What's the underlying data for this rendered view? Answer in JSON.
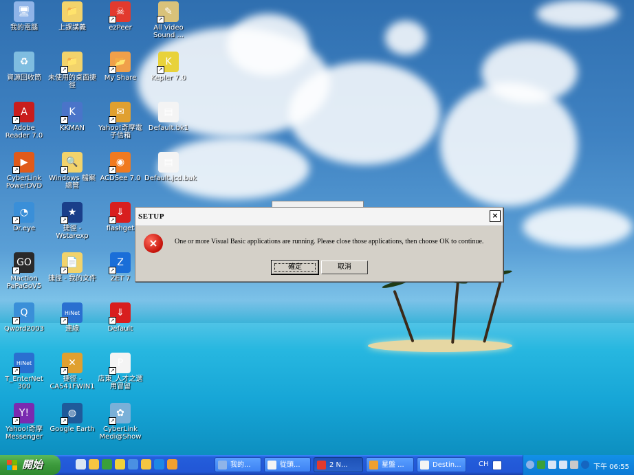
{
  "desktop_icons": [
    {
      "label": "我的電腦",
      "color": "#8fb4e8",
      "glyph": "🖥"
    },
    {
      "label": "上課講義",
      "color": "#f2d36b",
      "glyph": "📁"
    },
    {
      "label": "ezPeer",
      "color": "#e23a2e",
      "glyph": "☠"
    },
    {
      "label": "All Video Sound ...",
      "color": "#d9c27a",
      "glyph": "✎"
    },
    {
      "label": "資源回收筒",
      "color": "#7fbde0",
      "glyph": "♻"
    },
    {
      "label": "未使用的桌面捷徑",
      "color": "#f2d36b",
      "glyph": "📁"
    },
    {
      "label": "My Share",
      "color": "#f0a04a",
      "glyph": "📂"
    },
    {
      "label": "Kepler 7.0",
      "color": "#e8d23a",
      "glyph": "K"
    },
    {
      "label": "Adobe Reader 7.0",
      "color": "#c91d1d",
      "glyph": "A"
    },
    {
      "label": "KKMAN",
      "color": "#4a74c9",
      "glyph": "K"
    },
    {
      "label": "Yahoo!奇摩電子信箱",
      "color": "#e0a030",
      "glyph": "✉"
    },
    {
      "label": "Default.bk1",
      "color": "#f4f4f4",
      "glyph": "▤"
    },
    {
      "label": "CyberLink PowerDVD",
      "color": "#e05a1a",
      "glyph": "▶"
    },
    {
      "label": "Windows 檔案總管",
      "color": "#f2d36b",
      "glyph": "🔍"
    },
    {
      "label": "ACDSee 7.0",
      "color": "#f07a20",
      "glyph": "◉"
    },
    {
      "label": "Default.jcd.bak",
      "color": "#f4f4f4",
      "glyph": "▤"
    },
    {
      "label": "Dr.eye",
      "color": "#3a8fd8",
      "glyph": "◔"
    },
    {
      "label": "捷徑 - Wstarexp",
      "color": "#1a3f8a",
      "glyph": "★"
    },
    {
      "label": "flashget",
      "color": "#d81e1e",
      "glyph": "⇓"
    },
    {
      "label": "Maction PaPaGoV5",
      "color": "#2a2a2a",
      "glyph": "GO"
    },
    {
      "label": "捷徑 - 我的文件",
      "color": "#f2d36b",
      "glyph": "📄"
    },
    {
      "label": "ZET 7",
      "color": "#1a6ed8",
      "glyph": "Z"
    },
    {
      "label": "Qword2003",
      "color": "#3a8fd8",
      "glyph": "Q"
    },
    {
      "label": "連線",
      "color": "#2a6fd0",
      "glyph": "HiNet"
    },
    {
      "label": "Default",
      "color": "#d81e1e",
      "glyph": "⇓"
    },
    {
      "label": "T_EnterNet 300",
      "color": "#2a6fd0",
      "glyph": "HiNet"
    },
    {
      "label": "捷徑 - CA541FWIN1",
      "color": "#e0a030",
      "glyph": "✕"
    },
    {
      "label": "店東_人才之選用冒留",
      "color": "#f4f4f4",
      "glyph": "P"
    },
    {
      "label": "Yahoo!奇摩 Messenger",
      "color": "#7a2ab0",
      "glyph": "Y!"
    },
    {
      "label": "Google Earth",
      "color": "#1f5a9a",
      "glyph": "◍"
    },
    {
      "label": "CyberLink Medi@Show",
      "color": "#7ab0d8",
      "glyph": "✿"
    }
  ],
  "dialog": {
    "title": "SETUP",
    "close_label": "×",
    "error_icon": "×",
    "message": "One or more Visual Basic applications are running.  Please close those applications, then choose OK to continue.",
    "ok_label": "確定",
    "cancel_label": "取消"
  },
  "taskbar": {
    "start_label": "開始",
    "quick_launch_colors": [
      "#d9e6f5",
      "#f5c542",
      "#3aa03a",
      "#f0d23a",
      "#4a90e2",
      "#f5c542",
      "#1e88e5",
      "#f0a030"
    ],
    "tasks": [
      {
        "label": "我的...",
        "icon_color": "#8fb4e8",
        "active": false
      },
      {
        "label": "從頭...",
        "icon_color": "#f4f4f4",
        "active": false
      },
      {
        "label": "2 N...",
        "icon_color": "#e23a2e",
        "active": true
      },
      {
        "label": "星盤 ...",
        "icon_color": "#f0a030",
        "active": false
      },
      {
        "label": "Destin...",
        "icon_color": "#f4f4f4",
        "active": false
      }
    ],
    "lang": "CH",
    "clock": "下午 06:55"
  }
}
